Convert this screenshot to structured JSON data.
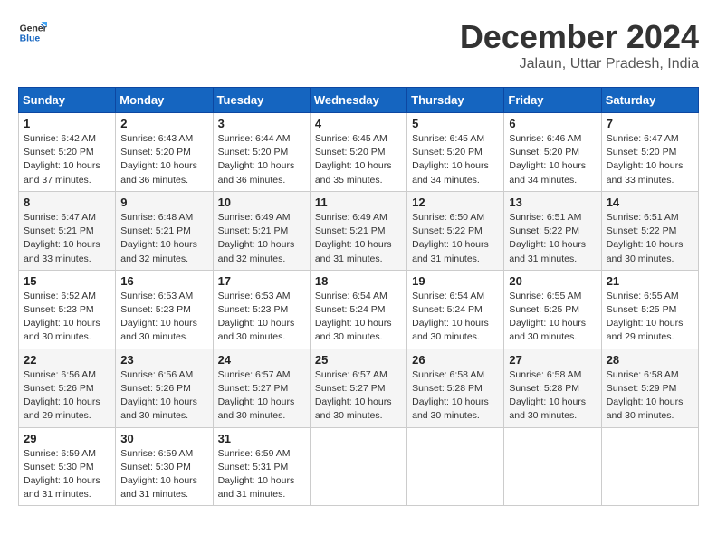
{
  "header": {
    "logo_line1": "General",
    "logo_line2": "Blue",
    "month": "December 2024",
    "location": "Jalaun, Uttar Pradesh, India"
  },
  "weekdays": [
    "Sunday",
    "Monday",
    "Tuesday",
    "Wednesday",
    "Thursday",
    "Friday",
    "Saturday"
  ],
  "weeks": [
    [
      {
        "day": "1",
        "sunrise": "6:42 AM",
        "sunset": "5:20 PM",
        "daylight": "10 hours and 37 minutes."
      },
      {
        "day": "2",
        "sunrise": "6:43 AM",
        "sunset": "5:20 PM",
        "daylight": "10 hours and 36 minutes."
      },
      {
        "day": "3",
        "sunrise": "6:44 AM",
        "sunset": "5:20 PM",
        "daylight": "10 hours and 36 minutes."
      },
      {
        "day": "4",
        "sunrise": "6:45 AM",
        "sunset": "5:20 PM",
        "daylight": "10 hours and 35 minutes."
      },
      {
        "day": "5",
        "sunrise": "6:45 AM",
        "sunset": "5:20 PM",
        "daylight": "10 hours and 34 minutes."
      },
      {
        "day": "6",
        "sunrise": "6:46 AM",
        "sunset": "5:20 PM",
        "daylight": "10 hours and 34 minutes."
      },
      {
        "day": "7",
        "sunrise": "6:47 AM",
        "sunset": "5:20 PM",
        "daylight": "10 hours and 33 minutes."
      }
    ],
    [
      {
        "day": "8",
        "sunrise": "6:47 AM",
        "sunset": "5:21 PM",
        "daylight": "10 hours and 33 minutes."
      },
      {
        "day": "9",
        "sunrise": "6:48 AM",
        "sunset": "5:21 PM",
        "daylight": "10 hours and 32 minutes."
      },
      {
        "day": "10",
        "sunrise": "6:49 AM",
        "sunset": "5:21 PM",
        "daylight": "10 hours and 32 minutes."
      },
      {
        "day": "11",
        "sunrise": "6:49 AM",
        "sunset": "5:21 PM",
        "daylight": "10 hours and 31 minutes."
      },
      {
        "day": "12",
        "sunrise": "6:50 AM",
        "sunset": "5:22 PM",
        "daylight": "10 hours and 31 minutes."
      },
      {
        "day": "13",
        "sunrise": "6:51 AM",
        "sunset": "5:22 PM",
        "daylight": "10 hours and 31 minutes."
      },
      {
        "day": "14",
        "sunrise": "6:51 AM",
        "sunset": "5:22 PM",
        "daylight": "10 hours and 30 minutes."
      }
    ],
    [
      {
        "day": "15",
        "sunrise": "6:52 AM",
        "sunset": "5:23 PM",
        "daylight": "10 hours and 30 minutes."
      },
      {
        "day": "16",
        "sunrise": "6:53 AM",
        "sunset": "5:23 PM",
        "daylight": "10 hours and 30 minutes."
      },
      {
        "day": "17",
        "sunrise": "6:53 AM",
        "sunset": "5:23 PM",
        "daylight": "10 hours and 30 minutes."
      },
      {
        "day": "18",
        "sunrise": "6:54 AM",
        "sunset": "5:24 PM",
        "daylight": "10 hours and 30 minutes."
      },
      {
        "day": "19",
        "sunrise": "6:54 AM",
        "sunset": "5:24 PM",
        "daylight": "10 hours and 30 minutes."
      },
      {
        "day": "20",
        "sunrise": "6:55 AM",
        "sunset": "5:25 PM",
        "daylight": "10 hours and 30 minutes."
      },
      {
        "day": "21",
        "sunrise": "6:55 AM",
        "sunset": "5:25 PM",
        "daylight": "10 hours and 29 minutes."
      }
    ],
    [
      {
        "day": "22",
        "sunrise": "6:56 AM",
        "sunset": "5:26 PM",
        "daylight": "10 hours and 29 minutes."
      },
      {
        "day": "23",
        "sunrise": "6:56 AM",
        "sunset": "5:26 PM",
        "daylight": "10 hours and 30 minutes."
      },
      {
        "day": "24",
        "sunrise": "6:57 AM",
        "sunset": "5:27 PM",
        "daylight": "10 hours and 30 minutes."
      },
      {
        "day": "25",
        "sunrise": "6:57 AM",
        "sunset": "5:27 PM",
        "daylight": "10 hours and 30 minutes."
      },
      {
        "day": "26",
        "sunrise": "6:58 AM",
        "sunset": "5:28 PM",
        "daylight": "10 hours and 30 minutes."
      },
      {
        "day": "27",
        "sunrise": "6:58 AM",
        "sunset": "5:28 PM",
        "daylight": "10 hours and 30 minutes."
      },
      {
        "day": "28",
        "sunrise": "6:58 AM",
        "sunset": "5:29 PM",
        "daylight": "10 hours and 30 minutes."
      }
    ],
    [
      {
        "day": "29",
        "sunrise": "6:59 AM",
        "sunset": "5:30 PM",
        "daylight": "10 hours and 31 minutes."
      },
      {
        "day": "30",
        "sunrise": "6:59 AM",
        "sunset": "5:30 PM",
        "daylight": "10 hours and 31 minutes."
      },
      {
        "day": "31",
        "sunrise": "6:59 AM",
        "sunset": "5:31 PM",
        "daylight": "10 hours and 31 minutes."
      },
      null,
      null,
      null,
      null
    ]
  ]
}
